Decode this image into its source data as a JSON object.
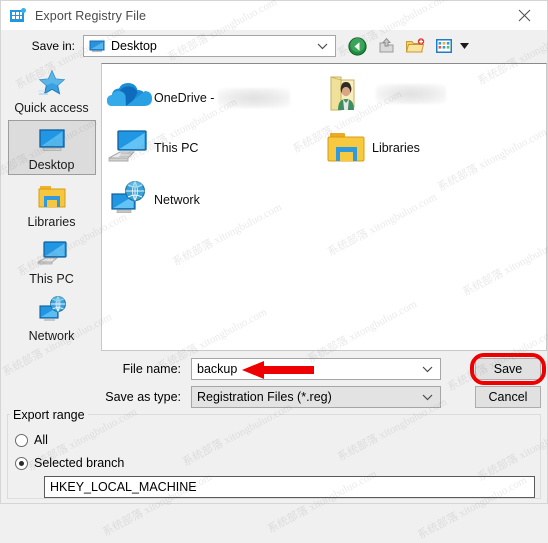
{
  "window": {
    "title": "Export Registry File",
    "icon": "registry-icon",
    "close_label": "×"
  },
  "savein": {
    "label": "Save in:",
    "value": "Desktop",
    "icon": "desktop-monitor-icon",
    "dropdown_icon": "chevron-down-icon"
  },
  "toolbar": {
    "buttons": [
      {
        "name": "back-button",
        "icon": "back-arrow-icon"
      },
      {
        "name": "up-one-level-button",
        "icon": "up-folder-icon"
      },
      {
        "name": "new-folder-button",
        "icon": "new-folder-icon"
      },
      {
        "name": "views-button",
        "icon": "views-grid-icon"
      }
    ],
    "views_arrow_icon": "chevron-down-icon"
  },
  "places": [
    {
      "label": "Quick access",
      "icon": "star-icon",
      "selected": false
    },
    {
      "label": "Desktop",
      "icon": "monitor-icon",
      "selected": true
    },
    {
      "label": "Libraries",
      "icon": "libraries-icon",
      "selected": false
    },
    {
      "label": "This PC",
      "icon": "this-pc-icon",
      "selected": false
    },
    {
      "label": "Network",
      "icon": "network-icon",
      "selected": false
    }
  ],
  "file_list": [
    {
      "label": "OneDrive -",
      "icon": "onedrive-cloud-icon",
      "blurred": true,
      "blur_width": 72
    },
    {
      "label": "",
      "icon": "user-folder-icon",
      "blurred": true,
      "blur_width": 70
    },
    {
      "label": "This PC",
      "icon": "this-pc-icon",
      "blurred": false,
      "blur_width": 0
    },
    {
      "label": "Libraries",
      "icon": "libraries-icon",
      "blurred": false,
      "blur_width": 0
    },
    {
      "label": "Network",
      "icon": "network-icon",
      "blurred": false,
      "blur_width": 0
    }
  ],
  "form": {
    "filename_label": "File name:",
    "filename_value": "backup",
    "filename_placeholder": "File name",
    "filetype_label": "Save as type:",
    "filetype_value": "Registration Files (*.reg)",
    "dropdown_icon": "chevron-down-icon"
  },
  "buttons": {
    "save": "Save",
    "cancel": "Cancel"
  },
  "export_range": {
    "legend": "Export range",
    "options": [
      {
        "label": "All",
        "checked": false
      },
      {
        "label": "Selected branch",
        "checked": true
      }
    ],
    "branch_value": "HKEY_LOCAL_MACHINE"
  },
  "annotations": {
    "arrow_color": "#ef0000",
    "box_color": "#ef0000",
    "arrow_target": "filename-field",
    "box_target": "save-button"
  },
  "watermark": {
    "text": "系统部落 xitongbuluo.com"
  },
  "colors": {
    "dialog_bg": "#f0f0f0",
    "titlebar_bg": "#ffffff",
    "list_bg": "#ffffff",
    "accent": "#2196e3",
    "selected_place_bg": "#dcdcdc",
    "button_bg": "#e1e1e1"
  }
}
